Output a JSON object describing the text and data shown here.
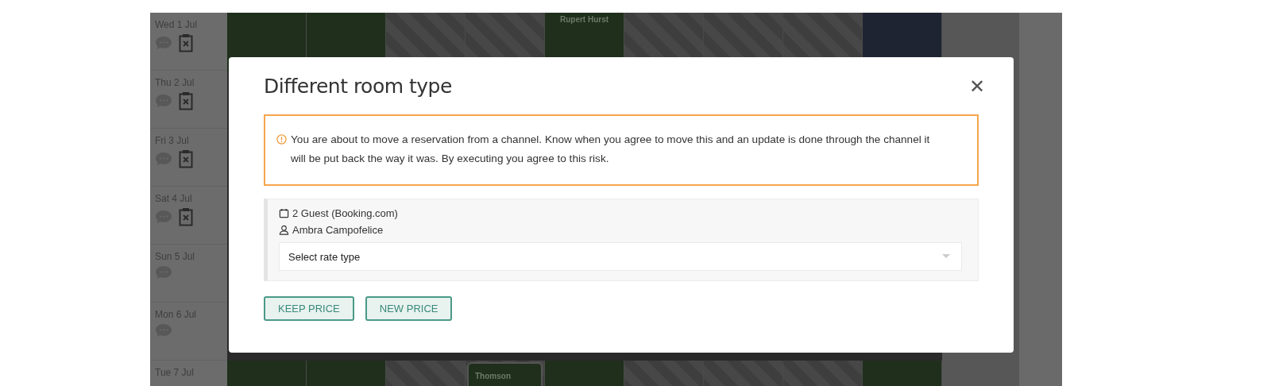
{
  "calendar": {
    "days": [
      {
        "date": "Wed 1 Jul",
        "chat": true,
        "checklist": true,
        "cells": [
          {
            "kind": "free"
          },
          {
            "kind": "free"
          },
          {
            "kind": "blocked"
          },
          {
            "kind": "blocked"
          },
          {
            "kind": "booked",
            "guest": "Rupert Hurst"
          },
          {
            "kind": "blocked"
          },
          {
            "kind": "blocked"
          },
          {
            "kind": "blocked"
          },
          {
            "kind": "selected"
          }
        ]
      },
      {
        "date": "Thu 2 Jul",
        "chat": true,
        "checklist": true
      },
      {
        "date": "Fri 3 Jul",
        "chat": true,
        "checklist": true
      },
      {
        "date": "Sat 4 Jul",
        "chat": true,
        "checklist": true
      },
      {
        "date": "Sun 5 Jul",
        "chat": true,
        "checklist": false
      },
      {
        "date": "Mon 6 Jul",
        "chat": true,
        "checklist": false
      },
      {
        "date": "Tue 7 Jul",
        "chat": false,
        "checklist": false,
        "cells": [
          {
            "kind": "free"
          },
          {
            "kind": "free"
          },
          {
            "kind": "blocked"
          },
          {
            "kind": "booked",
            "guest": "Thomson"
          },
          {
            "kind": "free"
          },
          {
            "kind": "blocked"
          },
          {
            "kind": "blocked"
          },
          {
            "kind": "blocked"
          },
          {
            "kind": "free"
          }
        ]
      }
    ]
  },
  "dialog": {
    "title": "Different room type",
    "close": "✕",
    "warning": "You are about to move a reservation from a channel. Know when you agree to move this and an update is done through the channel it will be put back the way it was. By executing you agree to this risk.",
    "reservation": "2 Guest (Booking.com)",
    "guest": "Ambra Campofelice",
    "rate_select": {
      "value": "Select rate type"
    },
    "buttons": [
      "KEEP PRICE",
      "NEW PRICE"
    ]
  }
}
